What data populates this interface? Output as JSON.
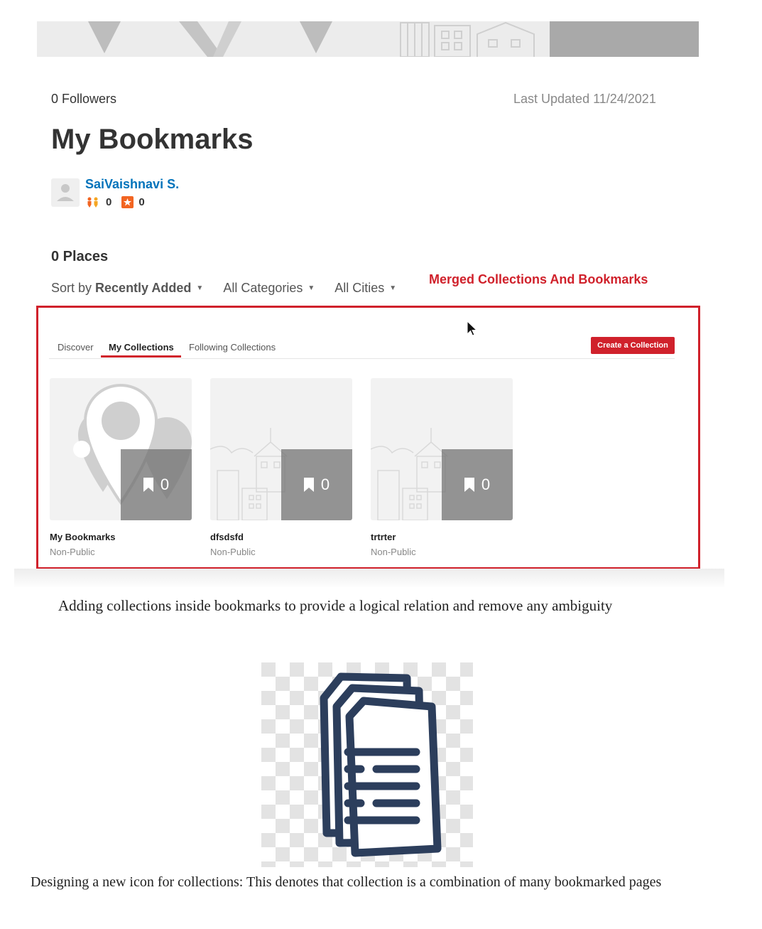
{
  "profile": {
    "followers": "0 Followers",
    "last_updated": "Last Updated 11/24/2021",
    "title": "My Bookmarks",
    "user_name": "SaiVaishnavi S.",
    "friends_count": "0",
    "reviews_count": "0"
  },
  "places": {
    "count_label": "0 Places",
    "sort_prefix": "Sort by ",
    "sort_value": "Recently Added",
    "categories_filter": "All Categories",
    "cities_filter": "All Cities"
  },
  "annotation": "Merged Collections And Bookmarks",
  "tabs": [
    {
      "label": "Discover"
    },
    {
      "label": "My Collections",
      "active": true
    },
    {
      "label": "Following Collections"
    }
  ],
  "create_button": "Create a Collection",
  "collections": [
    {
      "title": "My Bookmarks",
      "privacy": "Non-Public",
      "count": "0",
      "image": "map-pins"
    },
    {
      "title": "dfsdsfd",
      "privacy": "Non-Public",
      "count": "0",
      "image": "buildings"
    },
    {
      "title": "trtrter",
      "privacy": "Non-Public",
      "count": "0",
      "image": "buildings"
    }
  ],
  "captions": {
    "first": "Adding collections inside bookmarks to provide a logical relation and remove any ambiguity",
    "second": "Designing a new icon for collections: This denotes that collection is a combination of many bookmarked pages"
  },
  "colors": {
    "accent_red": "#d0212b",
    "link_blue": "#0073bb",
    "icon_navy": "#2c3e5c"
  }
}
